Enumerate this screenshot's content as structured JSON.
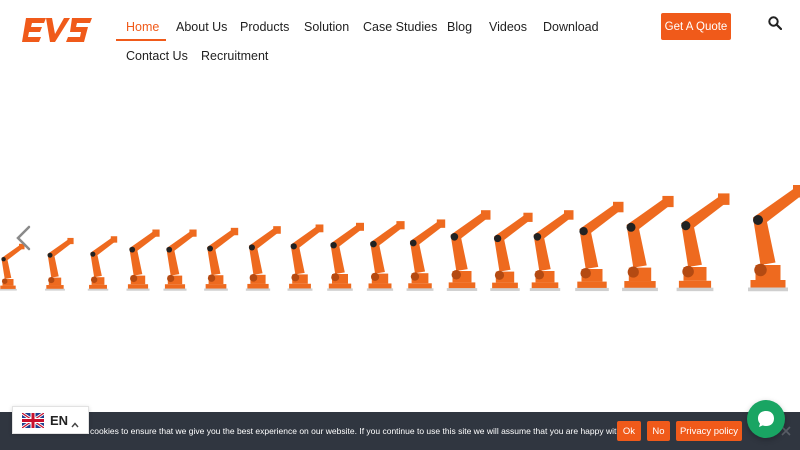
{
  "header": {
    "logo_text": "EVS",
    "nav": [
      {
        "label": "Home",
        "active": true
      },
      {
        "label": "About Us"
      },
      {
        "label": "Products"
      },
      {
        "label": "Solution"
      },
      {
        "label": "Case Studies"
      },
      {
        "label": "Blog"
      },
      {
        "label": "Videos"
      },
      {
        "label": "Download"
      },
      {
        "label": "Contact Us"
      },
      {
        "label": "Recruitment"
      }
    ],
    "quote_button": "Get A Quote",
    "search_icon": "search-icon"
  },
  "hero": {
    "image": "orange-industrial-robot-arm-lineup",
    "prev_icon": "chevron-left-icon",
    "robot_color": "#ee6a1f"
  },
  "cookie": {
    "text": "cookies to ensure that we give you the best experience on our website. If you continue to use this site we will assume that you are happy with it.",
    "ok": "Ok",
    "no": "No",
    "privacy": "Privacy policy",
    "close_icon": "close-icon"
  },
  "language": {
    "code": "EN",
    "flag_icon": "uk-flag-icon",
    "caret_icon": "chevron-up-icon"
  },
  "chat": {
    "icon": "chat-bubble-icon",
    "color": "#19a563"
  },
  "colors": {
    "accent": "#f05a1a",
    "cookie_bg": "#303640"
  }
}
